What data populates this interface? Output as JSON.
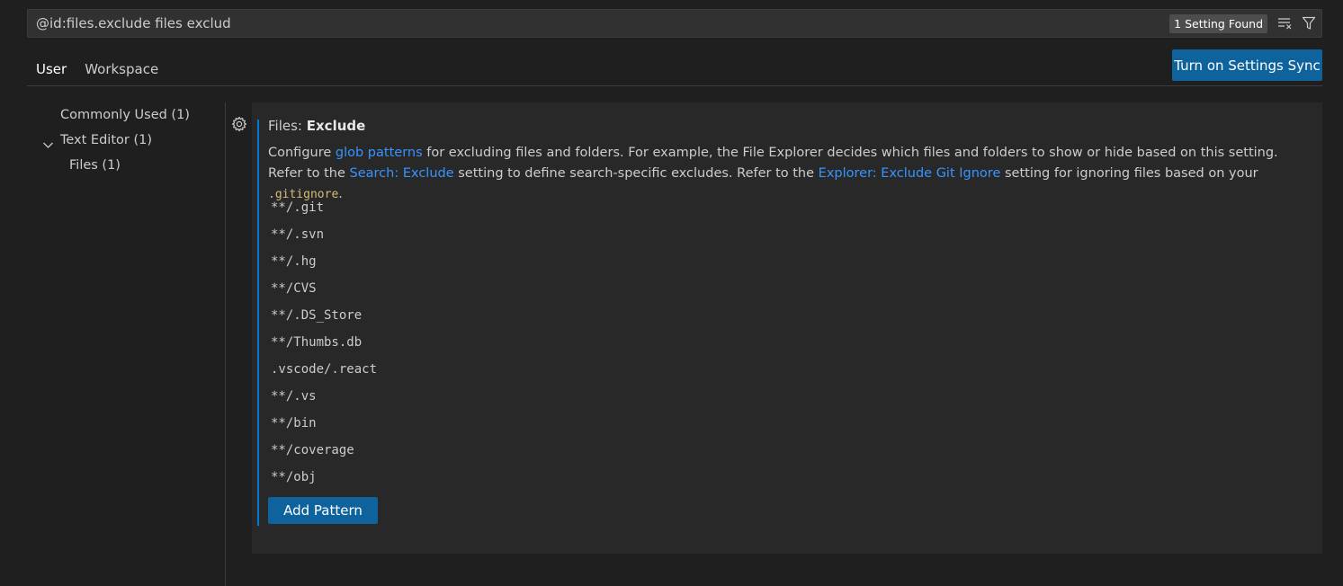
{
  "search": {
    "value": "@id:files.exclude files exclud",
    "result_count": "1 Setting Found",
    "clear_icon": "clear-filter-icon",
    "filter_icon": "filter-icon"
  },
  "tabs": [
    {
      "label": "User",
      "active": true
    },
    {
      "label": "Workspace",
      "active": false
    }
  ],
  "sync_button_label": "Turn on Settings Sync",
  "toc": {
    "commonly_used": "Commonly Used (1)",
    "text_editor": "Text Editor (1)",
    "files": "Files (1)"
  },
  "setting": {
    "category": "Files: ",
    "name": "Exclude",
    "desc": {
      "p1": "Configure ",
      "link1": "glob patterns",
      "p2": " for excluding files and folders. For example, the File Explorer decides which files and folders to show or hide based on this setting. Refer to the ",
      "link2": "Search: Exclude",
      "p3": " setting to define search-specific excludes. Refer to the ",
      "link3": "Explorer: Exclude Git Ignore",
      "p4": " setting for ignoring files based on your ",
      "code": ".gitignore",
      "p5": "."
    },
    "patterns": [
      "**/.git",
      "**/.svn",
      "**/.hg",
      "**/CVS",
      "**/.DS_Store",
      "**/Thumbs.db",
      ".vscode/.react",
      "**/.vs",
      "**/bin",
      "**/coverage",
      "**/obj"
    ],
    "add_button_label": "Add Pattern"
  },
  "colors": {
    "accent": "#0078d4",
    "button": "#0e639c",
    "link": "#3794ff",
    "background": "#1f1f1f",
    "panel": "#282828"
  }
}
